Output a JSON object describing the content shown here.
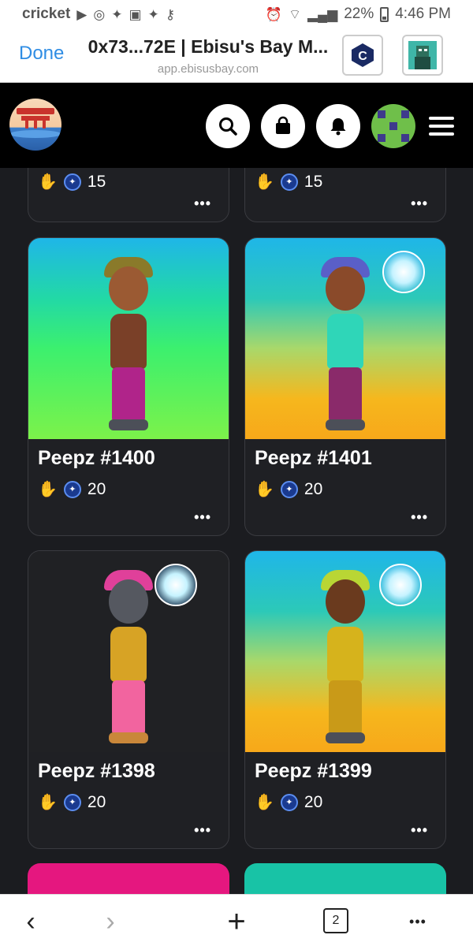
{
  "status": {
    "carrier": "cricket",
    "battery": "22%",
    "time": "4:46 PM"
  },
  "browser": {
    "done_label": "Done",
    "page_title": "0x73...72E | Ebisu's Bay M...",
    "url": "app.ebisusbay.com"
  },
  "header": {
    "icons": [
      "search-icon",
      "bag-icon",
      "bell-icon",
      "avatar",
      "menu-icon"
    ]
  },
  "cards_top_partial": [
    {
      "price": "15",
      "more": "•••"
    },
    {
      "price": "15",
      "more": "•••"
    }
  ],
  "cards": [
    {
      "name": "Peepz #1400",
      "price": "20",
      "more": "•••",
      "bg": "green"
    },
    {
      "name": "Peepz #1401",
      "price": "20",
      "more": "•••",
      "bg": "orange"
    },
    {
      "name": "Peepz #1398",
      "price": "20",
      "more": "•••",
      "bg": "dark"
    },
    {
      "name": "Peepz #1399",
      "price": "20",
      "more": "•••",
      "bg": "orange"
    }
  ],
  "bottom_nav": {
    "back": "‹",
    "forward": "›",
    "new_tab": "+",
    "tab_count": "2",
    "more": "•••"
  },
  "colors": {
    "accent_link": "#2f8de4",
    "header_bg": "#000000",
    "page_bg": "#1b1c20",
    "card_bg": "#1f2024",
    "partial_pink": "#e5177f",
    "partial_teal": "#18c3a6"
  }
}
